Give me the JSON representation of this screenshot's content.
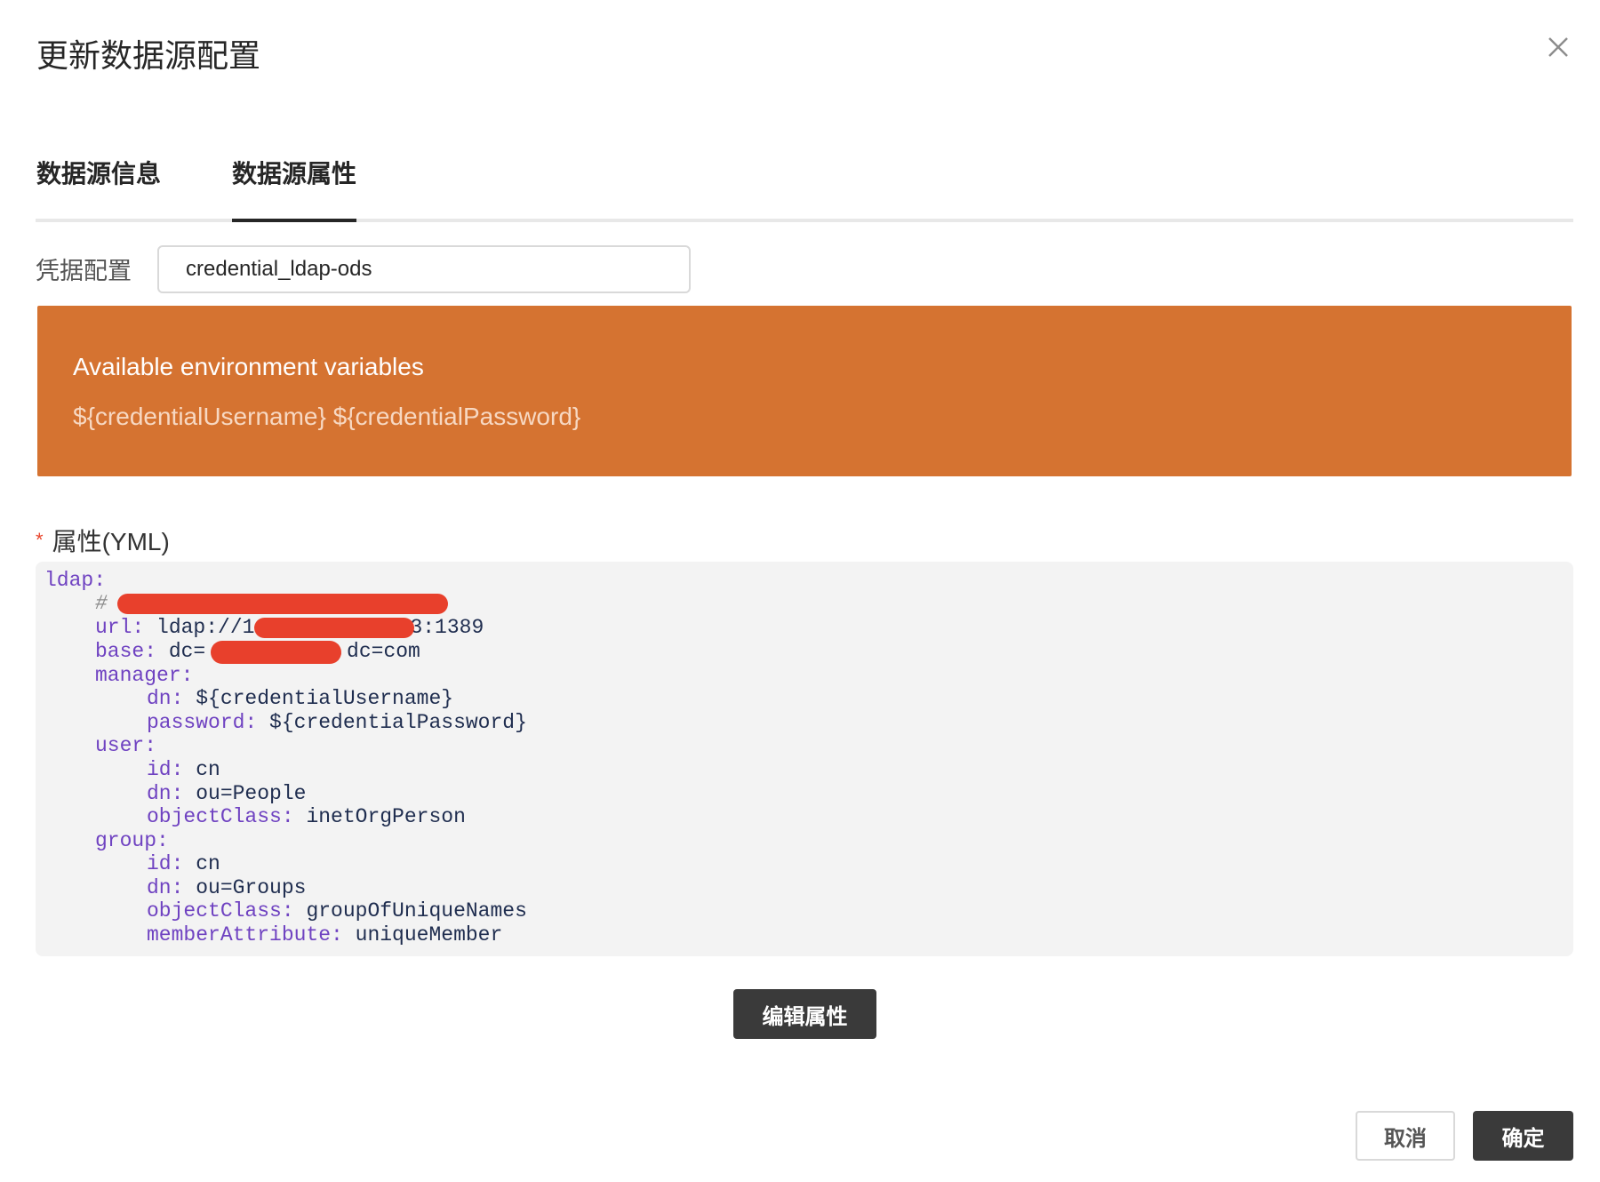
{
  "dialog": {
    "title": "更新数据源配置"
  },
  "tabs": [
    {
      "label": "数据源信息",
      "active": false
    },
    {
      "label": "数据源属性",
      "active": true
    }
  ],
  "credential": {
    "label": "凭据配置",
    "value": "credential_ldap-ods"
  },
  "env_banner": {
    "title": "Available environment variables",
    "vars": "${credentialUsername} ${credentialPassword}",
    "color": "#d57331"
  },
  "properties": {
    "required_mark": "*",
    "label": "属性(YML)",
    "code": {
      "l0_key": "ldap:",
      "l1_comment": "#",
      "l2_key": "url:",
      "l2_val_a": " ldap://1",
      "l2_val_b": "3:1389",
      "l3_key": "base:",
      "l3_val_a": " dc=",
      "l3_val_b": ",dc=com",
      "l4_key": "manager:",
      "l5_key": "dn:",
      "l5_val": " ${credentialUsername}",
      "l6_key": "password:",
      "l6_val": " ${credentialPassword}",
      "l7_key": "user:",
      "l8_key": "id:",
      "l8_val": " cn",
      "l9_key": "dn:",
      "l9_val": " ou=People",
      "l10_key": "objectClass:",
      "l10_val": " inetOrgPerson",
      "l11_key": "group:",
      "l12_key": "id:",
      "l12_val": " cn",
      "l13_key": "dn:",
      "l13_val": " ou=Groups",
      "l14_key": "objectClass:",
      "l14_val": " groupOfUniqueNames",
      "l15_key": "memberAttribute:",
      "l15_val": " uniqueMember"
    }
  },
  "buttons": {
    "edit": "编辑属性",
    "cancel": "取消",
    "ok": "确定"
  },
  "icons": {
    "close": "close-icon"
  }
}
